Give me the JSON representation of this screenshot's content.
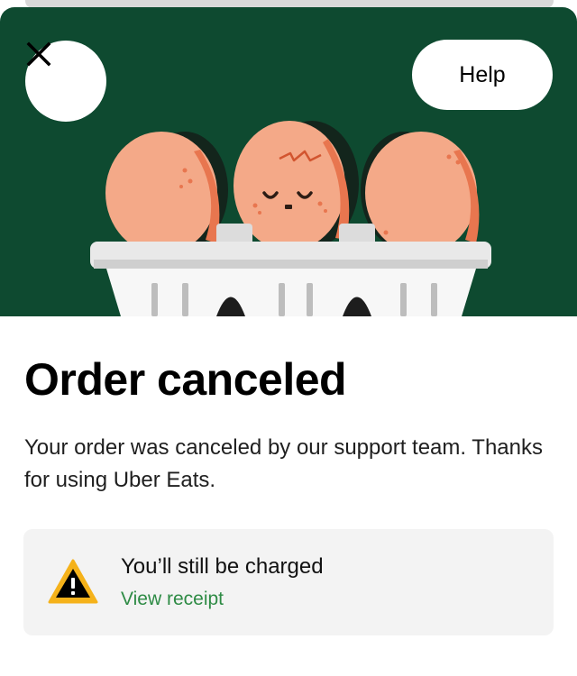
{
  "header": {
    "close_icon": "close-icon",
    "help_label": "Help"
  },
  "main": {
    "title": "Order canceled",
    "message": "Your order was canceled by our support team. Thanks for using Uber Eats."
  },
  "notice": {
    "icon": "warning-icon",
    "text": "You’ll still be charged",
    "link_label": "View receipt"
  },
  "colors": {
    "hero_background": "#0e4a30",
    "link": "#2e8b45",
    "warning": "#f5b21a"
  }
}
